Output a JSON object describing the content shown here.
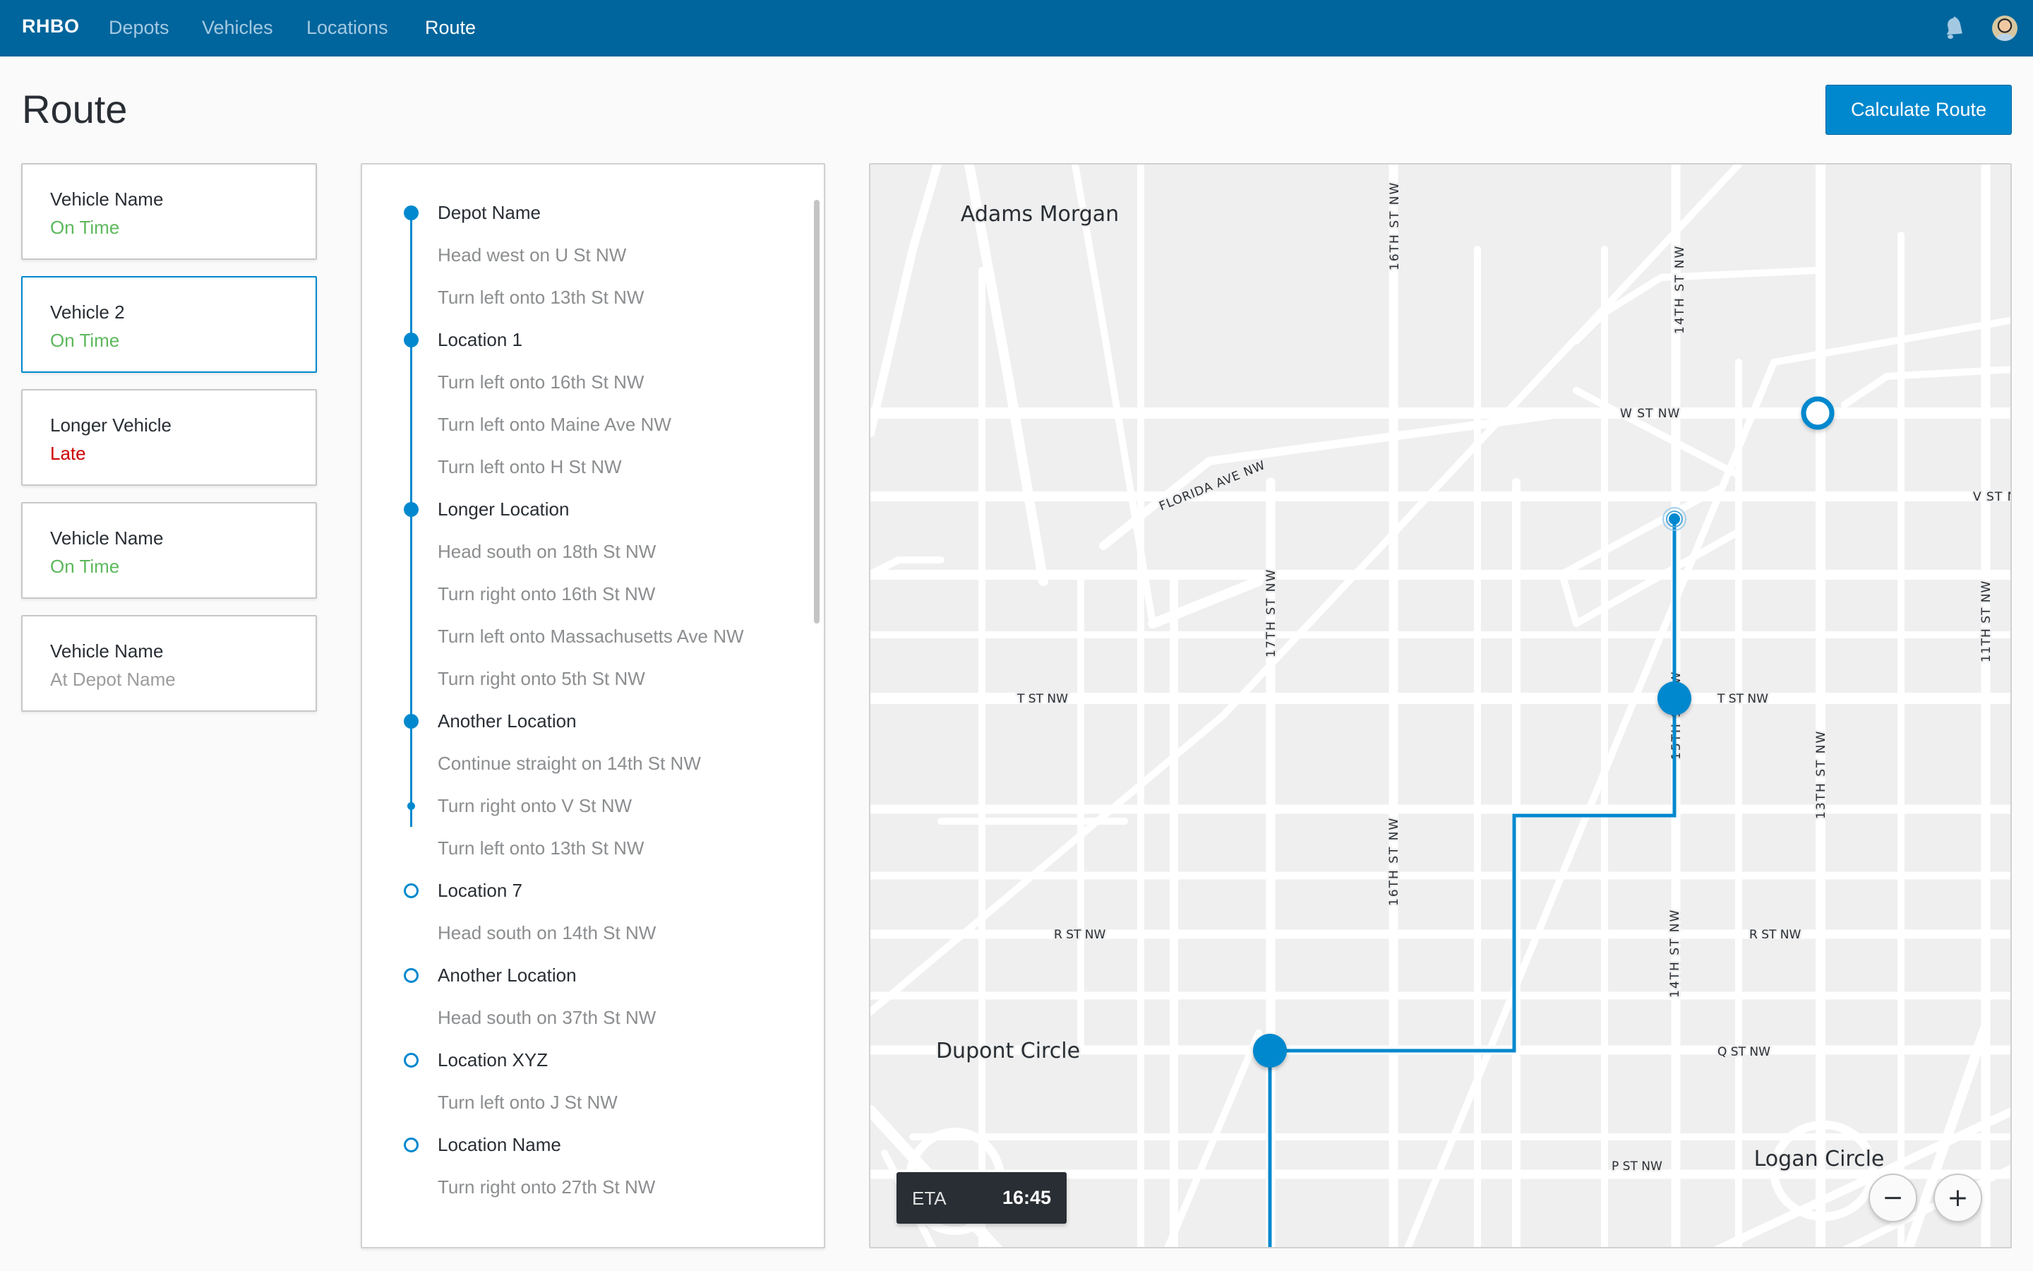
{
  "header": {
    "brand": "RHBO",
    "nav": [
      {
        "label": "Depots",
        "active": false
      },
      {
        "label": "Vehicles",
        "active": false
      },
      {
        "label": "Locations",
        "active": false
      },
      {
        "label": "Route",
        "active": true
      }
    ],
    "icons": {
      "notifications": "bell-icon",
      "user": "avatar"
    }
  },
  "page": {
    "title": "Route",
    "calculate_button": "Calculate Route"
  },
  "vehicles": [
    {
      "name": "Vehicle Name",
      "status": "On Time",
      "status_type": "ontime",
      "selected": false
    },
    {
      "name": "Vehicle 2",
      "status": "On Time",
      "status_type": "ontime",
      "selected": true
    },
    {
      "name": "Longer Vehicle",
      "status": "Late",
      "status_type": "late",
      "selected": false
    },
    {
      "name": "Vehicle Name",
      "status": "On Time",
      "status_type": "ontime",
      "selected": false
    },
    {
      "name": "Vehicle Name",
      "status": "At Depot Name",
      "status_type": "depot",
      "selected": false
    }
  ],
  "route_steps": [
    {
      "text": "Depot Name",
      "kind": "stop",
      "marker": "filled"
    },
    {
      "text": "Head west on U St NW",
      "kind": "step",
      "marker": "none"
    },
    {
      "text": "Turn left onto 13th St NW",
      "kind": "step",
      "marker": "none"
    },
    {
      "text": "Location 1",
      "kind": "stop",
      "marker": "filled"
    },
    {
      "text": "Turn left onto 16th St NW",
      "kind": "step",
      "marker": "none"
    },
    {
      "text": "Turn left onto Maine Ave NW",
      "kind": "step",
      "marker": "none"
    },
    {
      "text": "Turn left onto H St NW",
      "kind": "step",
      "marker": "none"
    },
    {
      "text": "Longer Location",
      "kind": "stop",
      "marker": "filled"
    },
    {
      "text": "Head south on 18th St NW",
      "kind": "step",
      "marker": "none"
    },
    {
      "text": "Turn right onto 16th St NW",
      "kind": "step",
      "marker": "none"
    },
    {
      "text": "Turn left onto Massachusetts Ave NW",
      "kind": "step",
      "marker": "none"
    },
    {
      "text": "Turn right onto 5th St NW",
      "kind": "step",
      "marker": "none"
    },
    {
      "text": "Another Location",
      "kind": "stop",
      "marker": "filled"
    },
    {
      "text": "Continue straight on 14th St NW",
      "kind": "step",
      "marker": "none"
    },
    {
      "text": "Turn right onto V St NW",
      "kind": "step",
      "marker": "current"
    },
    {
      "text": "Turn left onto 13th St NW",
      "kind": "step",
      "marker": "none"
    },
    {
      "text": "Location 7",
      "kind": "stop",
      "marker": "hollow"
    },
    {
      "text": "Head south on 14th St NW",
      "kind": "step",
      "marker": "none"
    },
    {
      "text": "Another Location",
      "kind": "stop",
      "marker": "hollow"
    },
    {
      "text": "Head south on 37th St NW",
      "kind": "step",
      "marker": "none"
    },
    {
      "text": "Location XYZ",
      "kind": "stop",
      "marker": "hollow"
    },
    {
      "text": "Turn left onto J St NW",
      "kind": "step",
      "marker": "none"
    },
    {
      "text": "Location Name",
      "kind": "stop",
      "marker": "hollow"
    },
    {
      "text": "Turn right onto 27th St NW",
      "kind": "step",
      "marker": "none"
    }
  ],
  "map": {
    "neighborhoods": [
      "Adams Morgan",
      "Dupont Circle",
      "Logan Circle"
    ],
    "street_labels": {
      "w_st": "W ST NW",
      "v_st": "V ST N",
      "t_st_left": "T ST NW",
      "t_st_right": "T ST NW",
      "r_st_left": "R ST NW",
      "r_st_right": "R ST NW",
      "q_st": "Q ST NW",
      "p_st": "P ST NW",
      "florida": "FLORIDA AVE NW",
      "st16_top": "16TH ST NW",
      "st16_mid": "16TH ST NW",
      "st14_top": "14TH ST NW",
      "st14_bottom": "14TH ST NW",
      "st17": "17TH ST NW",
      "st15": "15TH ST NW",
      "st13": "13TH ST NW",
      "st11": "11TH ST NW"
    },
    "eta_label": "ETA",
    "eta_value": "16:45",
    "zoom_out": "−",
    "zoom_in": "+",
    "route_color": "#0088ce"
  },
  "colors": {
    "header_bg": "#00659c",
    "accent": "#0088ce",
    "on_time": "#5cb85c",
    "late": "#cc0000",
    "muted": "#9c9c9c"
  }
}
